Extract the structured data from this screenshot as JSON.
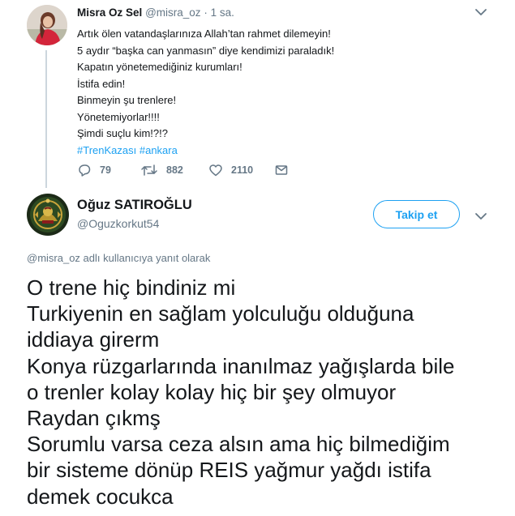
{
  "parent_tweet": {
    "name": "Misra Oz Sel",
    "handle": "@misra_oz",
    "separator": "·",
    "time": "1 sa.",
    "lines": [
      "Artık ölen vatandaşlarınıza Allah’tan rahmet dilemeyin!",
      "5 aydır “başka can yanmasın” diye kendimizi paraladık!",
      "Kapatın yönetemediğiniz kurumları!",
      "İstifa edin!",
      "Binmeyin şu trenlere!",
      "Yönetemiyorlar!!!!",
      "Şimdi suçlu kim!?!?"
    ],
    "hashtags": [
      "#TrenKazası",
      "#ankara"
    ],
    "actions": {
      "reply_count": "79",
      "retweet_count": "882",
      "like_count": "2110"
    }
  },
  "reply_tweet": {
    "name": "Oğuz SATIROĞLU",
    "handle": "@Oguzkorkut54",
    "follow_label": "Takip et",
    "reply_to": "@misra_oz adlı kullanıcıya yanıt olarak",
    "lines": [
      "O trene hiç bindiniz mi",
      "Turkiyenin en sağlam yolculuğu olduğuna",
      "iddiaya girerm",
      "Konya rüzgarlarında inanılmaz yağışlarda bile",
      "o trenler kolay kolay hiç bir şey olmuyor",
      "Raydan çıkmş",
      "Sorumlu varsa ceza alsın ama hiç bilmediğim",
      "bir sisteme dönüp REIS yağmur yağdı istifa",
      "demek cocukca"
    ]
  },
  "colors": {
    "accent": "#1da1f2",
    "text": "#14171a",
    "muted": "#657786",
    "thread_line": "#ccd6dd"
  },
  "icons": {
    "parent_avatar": "profile-photo",
    "reply_avatar": "ottoman-coat-of-arms",
    "reply": "speech-bubble-icon",
    "retweet": "retweet-arrows-icon",
    "like": "heart-icon",
    "message": "envelope-icon",
    "menu": "chevron-down-icon"
  }
}
